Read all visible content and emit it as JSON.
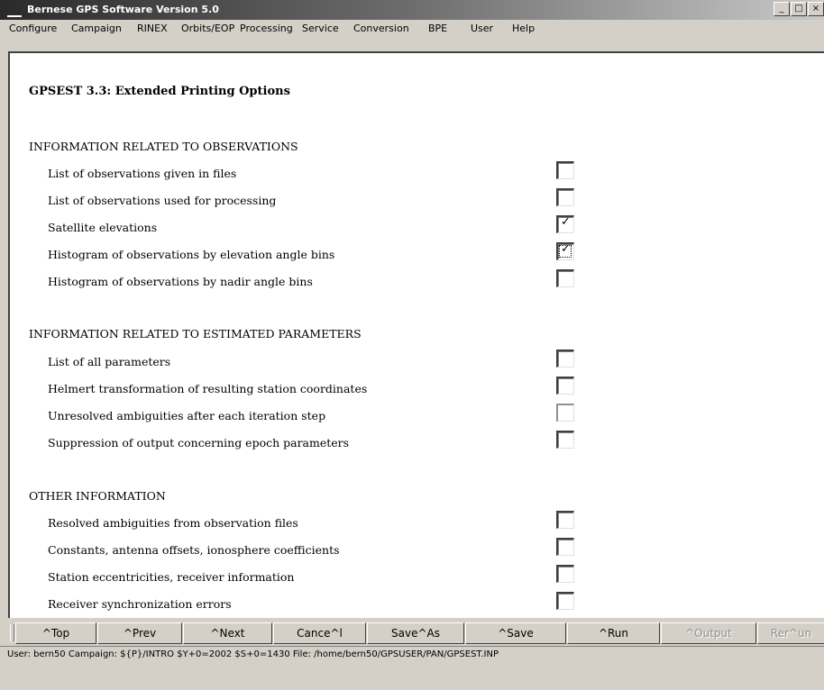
{
  "window": {
    "title": "Bernese GPS Software Version 5.0",
    "controls": [
      "_",
      "□",
      "×"
    ]
  },
  "menu": [
    "Configure",
    "Campaign",
    "RINEX",
    "Orbits/EOP",
    "Processing",
    "Service",
    "Conversion",
    "BPE",
    "User",
    "Help"
  ],
  "panel": {
    "title": "GPSEST 3.3: Extended Printing Options",
    "sections": [
      {
        "heading": "INFORMATION RELATED TO OBSERVATIONS",
        "options": [
          {
            "label": "List of observations given in files",
            "checked": false
          },
          {
            "label": "List of observations used for processing",
            "checked": false
          },
          {
            "label": "Satellite elevations",
            "checked": true
          },
          {
            "label": "Histogram of observations by elevation angle bins",
            "checked": true,
            "focused": true
          },
          {
            "label": "Histogram of observations by nadir angle bins",
            "checked": false
          }
        ]
      },
      {
        "heading": "INFORMATION RELATED TO ESTIMATED PARAMETERS",
        "options": [
          {
            "label": "List of all parameters",
            "checked": false
          },
          {
            "label": "Helmert transformation of resulting station coordinates",
            "checked": false
          },
          {
            "label": "Unresolved ambiguities after each iteration step",
            "checked": false,
            "disabled": true
          },
          {
            "label": "Suppression of output concerning epoch parameters",
            "checked": false
          }
        ]
      },
      {
        "heading": "OTHER INFORMATION",
        "options": [
          {
            "label": "Resolved ambiguities from observation files",
            "checked": false
          },
          {
            "label": "Constants, antenna offsets, ionosphere coefficients",
            "checked": false
          },
          {
            "label": "Station eccentricities, receiver information",
            "checked": false
          },
          {
            "label": "Receiver synchronization errors",
            "checked": false
          }
        ]
      }
    ]
  },
  "buttons": [
    {
      "label": "^Top",
      "enabled": true
    },
    {
      "label": "^Prev",
      "enabled": true
    },
    {
      "label": "^Next",
      "enabled": true
    },
    {
      "label": "Cance^l",
      "enabled": true
    },
    {
      "label": "Save^As",
      "enabled": true
    },
    {
      "label": "^Save",
      "enabled": true
    },
    {
      "label": "^Run",
      "enabled": true
    },
    {
      "label": "^Output",
      "enabled": false
    },
    {
      "label": "Rer^un",
      "enabled": false
    }
  ],
  "status": {
    "text": "User: bern50  Campaign: ${P}/INTRO  $Y+0=2002  $S+0=1430  File: /home/bern50/GPSUSER/PAN/GPSEST.INP"
  }
}
